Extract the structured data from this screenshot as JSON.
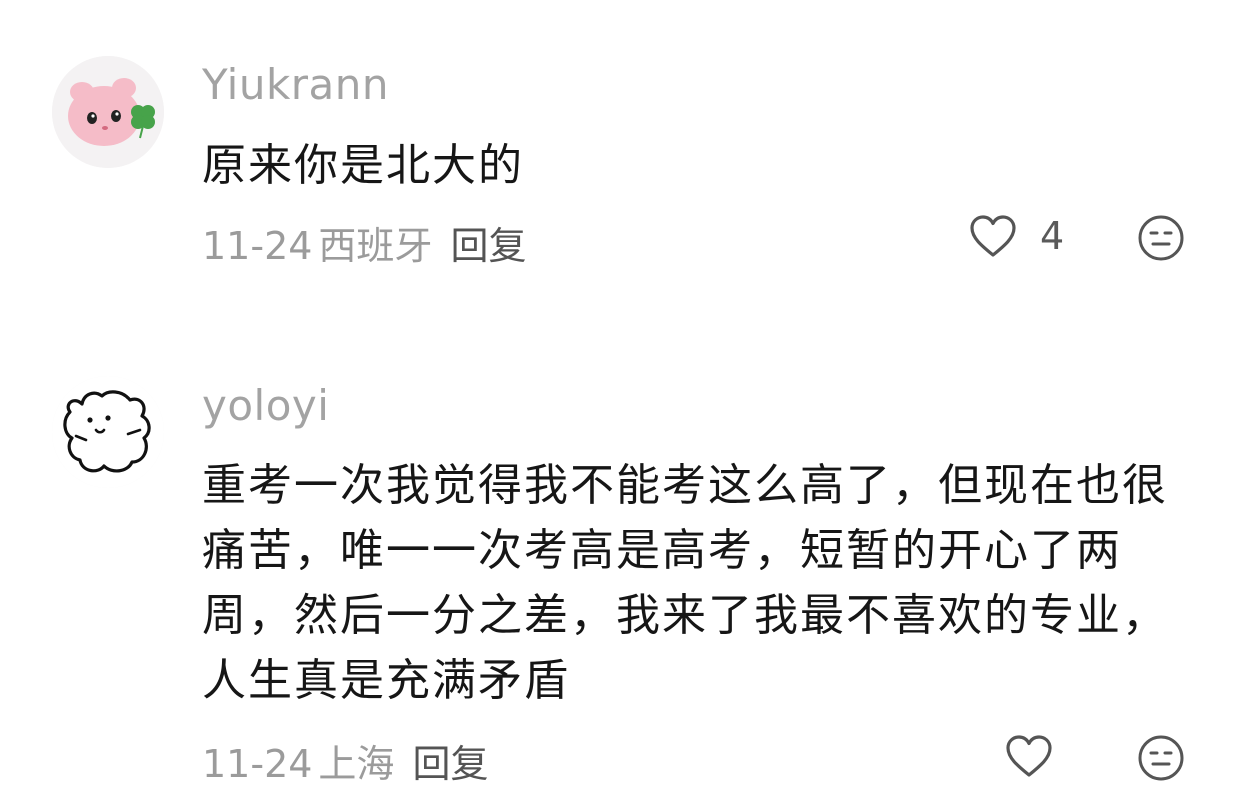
{
  "comments": [
    {
      "username": "Yiukrann",
      "content": "原来你是北大的",
      "date": "11-24",
      "location": "西班牙",
      "reply_label": "回复",
      "like_count": "4",
      "avatar": "pink-creature-with-clover-icon"
    },
    {
      "username": "yoloyi",
      "content": "重考一次我觉得我不能考这么高了，但现在也很痛苦，唯一一次考高是高考，短暂的开心了两周，然后一分之差，我来了我最不喜欢的专业，人生真是充满矛盾",
      "date": "11-24",
      "location": "上海",
      "reply_label": "回复",
      "like_count": "",
      "avatar": "doodle-bear-icon"
    }
  ],
  "icons": {
    "like": "heart-outline-icon",
    "emoji": "neutral-face-icon"
  },
  "colors": {
    "username": "#a3a3a3",
    "content": "#161616",
    "meta": "#9b9b9b",
    "reply": "#545454",
    "icon_stroke": "#555555"
  }
}
